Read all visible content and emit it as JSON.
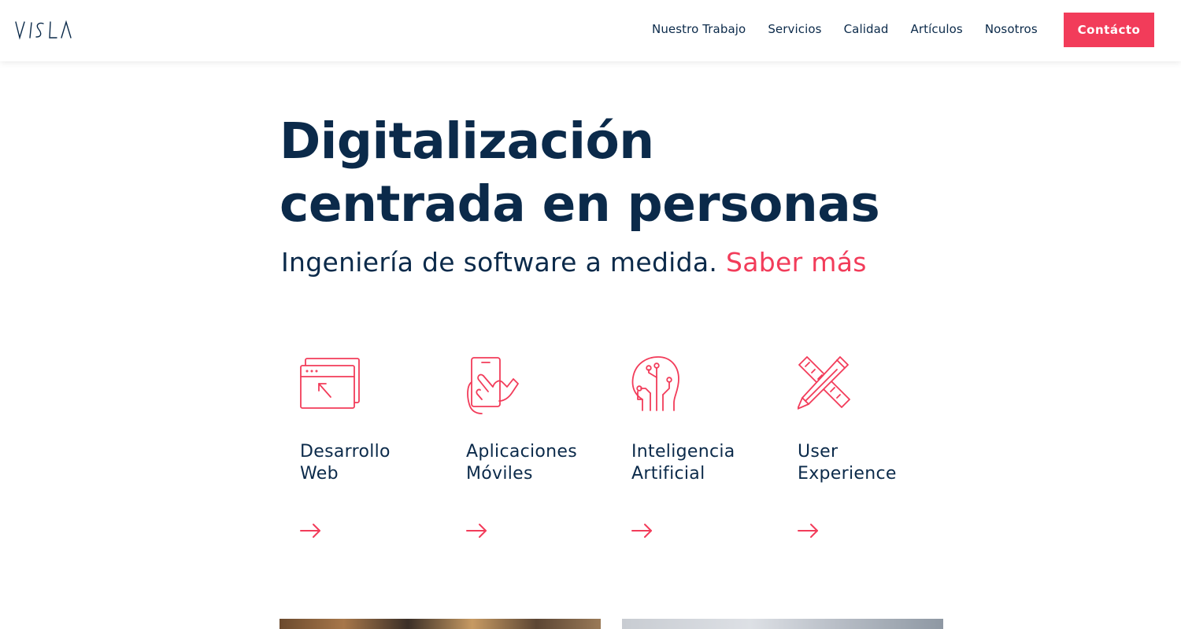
{
  "header": {
    "logo_text": "VISLA",
    "nav": [
      "Nuestro Trabajo",
      "Servicios",
      "Calidad",
      "Artículos",
      "Nosotros"
    ],
    "contact_label": "Contácto"
  },
  "hero": {
    "title_line1": "Digitalización",
    "title_line2": "centrada en personas",
    "subtitle": "Ingeniería de software a medida.",
    "more_link": "Saber más"
  },
  "services": [
    {
      "line1": "Desarrollo",
      "line2": "Web",
      "icon": "browser-window-cursor-icon"
    },
    {
      "line1": "Aplicaciones",
      "line2": "Móviles",
      "icon": "hand-smartphone-icon"
    },
    {
      "line1": "Inteligencia",
      "line2": "Artificial",
      "icon": "brain-circuit-head-icon"
    },
    {
      "line1": "User",
      "line2": "Experience",
      "icon": "pencil-ruler-icon"
    }
  ],
  "colors": {
    "accent": "#f23c5a",
    "text": "#0b2a4a"
  }
}
